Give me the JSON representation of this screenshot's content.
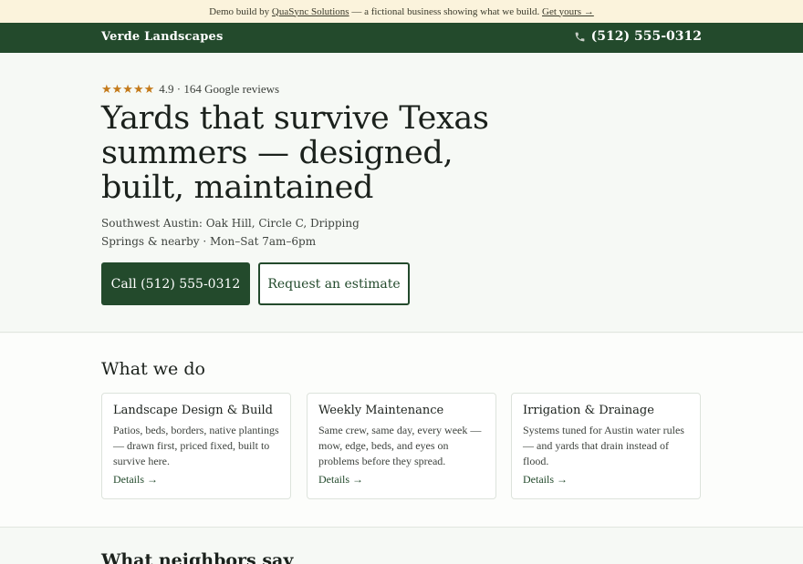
{
  "demo_bar": {
    "prefix": "Demo build by",
    "company": "QuaSync Solutions",
    "middle": "— a fictional business showing what we build.",
    "cta": "Get yours →"
  },
  "header": {
    "brand": "Verde Landscapes",
    "phone_icon": "phone-icon",
    "phone": "(512) 555-0312"
  },
  "hero": {
    "stars": "★★★★★",
    "rating": "4.9 · 164 Google reviews",
    "title": "Yards that survive Texas summers — designed, built, maintained",
    "subtitle": "Southwest Austin: Oak Hill, Circle C, Dripping Springs & nearby · Mon–Sat 7am–6pm",
    "call_button": "Call (512) 555-0312",
    "estimate_button": "Request an estimate"
  },
  "services": {
    "title": "What we do",
    "cards": [
      {
        "title": "Landscape Design & Build",
        "text": "Patios, beds, borders, native plantings — drawn first, priced fixed, built to survive here.",
        "link": "Details →"
      },
      {
        "title": "Weekly Maintenance",
        "text": "Same crew, same day, every week — mow, edge, beds, and eyes on problems before they spread.",
        "link": "Details →"
      },
      {
        "title": "Irrigation & Drainage",
        "text": "Systems tuned for Austin water rules — and yards that drain instead of flood.",
        "link": "Details →"
      }
    ]
  },
  "testimonials": {
    "title": "What neighbors say"
  },
  "colors": {
    "brand_green": "#234a2c",
    "star_gold": "#c47a1a",
    "banner_bg": "#fbf3dc"
  }
}
